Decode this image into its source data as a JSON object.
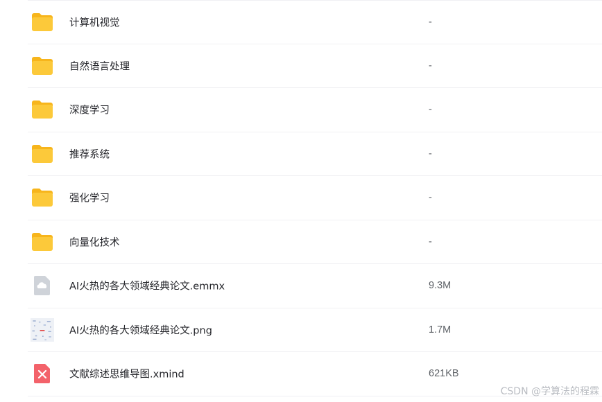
{
  "files": [
    {
      "name": "计算机视觉",
      "size": "-",
      "icon": "folder-icon"
    },
    {
      "name": "自然语言处理",
      "size": "-",
      "icon": "folder-icon"
    },
    {
      "name": "深度学习",
      "size": "-",
      "icon": "folder-icon"
    },
    {
      "name": "推荐系统",
      "size": "-",
      "icon": "folder-icon"
    },
    {
      "name": "强化学习",
      "size": "-",
      "icon": "folder-icon"
    },
    {
      "name": "向量化技术",
      "size": "-",
      "icon": "folder-icon"
    },
    {
      "name": "AI火热的各大领域经典论文.emmx",
      "size": "9.3M",
      "icon": "emmx-file-icon"
    },
    {
      "name": "AI火热的各大领域经典论文.png",
      "size": "1.7M",
      "icon": "image-thumbnail-icon"
    },
    {
      "name": "文献综述思维导图.xmind",
      "size": "621KB",
      "icon": "xmind-file-icon"
    }
  ],
  "watermark": "CSDN @学算法的程霖",
  "colors": {
    "folder": "#fcc93a",
    "emmx": "#cfd3d9",
    "xmind": "#f3626a",
    "divider": "#f0f0f3"
  }
}
